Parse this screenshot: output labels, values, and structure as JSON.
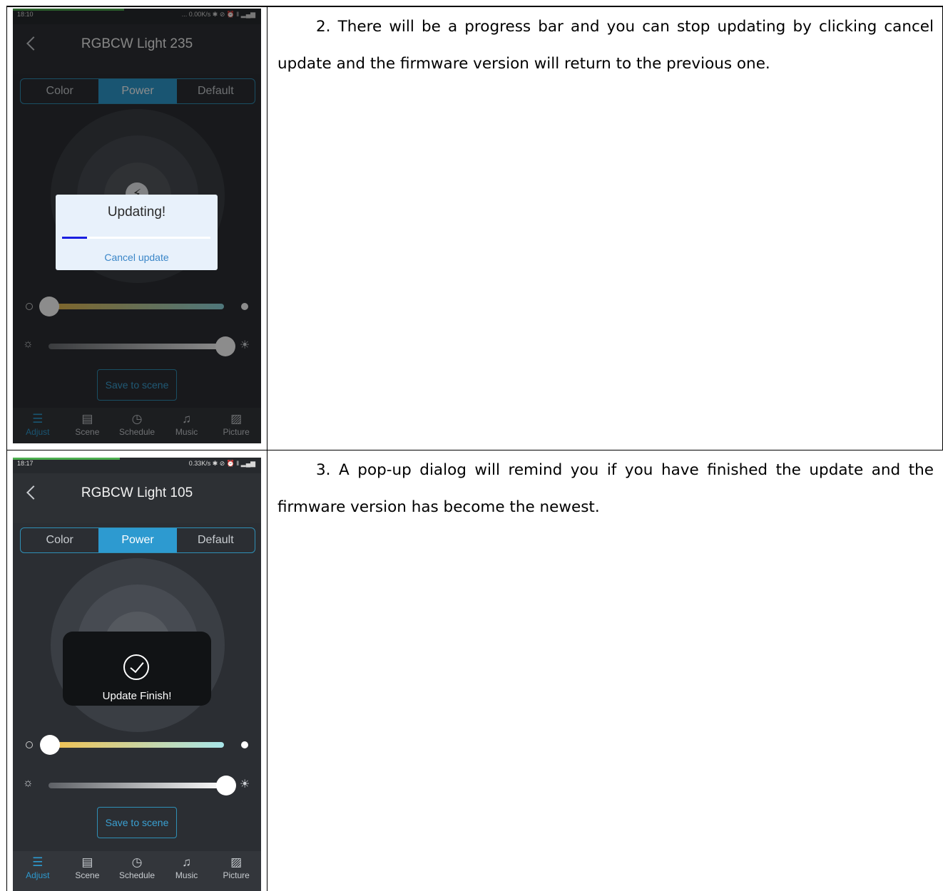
{
  "rows": [
    {
      "text": "2. There will be a progress bar and you can stop updating by clicking cancel update and the firmware version will return to the previous one.",
      "screenshot": {
        "status_time": "18:10",
        "status_net": "... 0.00K/s ✱ ⊘ ⏰ ‖ ▂▄▆",
        "title": "RGBCW Light 235",
        "tabs": [
          "Color",
          "Power",
          "Default"
        ],
        "active_tab": "Power",
        "save_label": "Save to scene",
        "nav": [
          "Adjust",
          "Scene",
          "Schedule",
          "Music",
          "Picture"
        ],
        "dialog": {
          "title": "Updating!",
          "progress": 0.17,
          "cancel_label": "Cancel update"
        }
      }
    },
    {
      "text": "3. A pop-up dialog will remind you if you have finished the update and the firmware version has become the newest.",
      "screenshot": {
        "status_time": "18:17",
        "status_net": "0.33K/s ✱ ⊘ ⏰ ‖ ▂▄▆",
        "title": "RGBCW Light 105",
        "tabs": [
          "Color",
          "Power",
          "Default"
        ],
        "active_tab": "Power",
        "save_label": "Save to scene",
        "nav": [
          "Adjust",
          "Scene",
          "Schedule",
          "Music",
          "Picture"
        ],
        "dialog": {
          "message": "Update Finish!"
        }
      }
    }
  ],
  "colors": {
    "accent": "#2d9ad0",
    "progress": "#1a1ee0",
    "status_bar_green": "#4cae4f"
  },
  "icons": {
    "nav": [
      "sliders-icon",
      "clapperboard-icon",
      "clock-icon",
      "music-note-icon",
      "picture-icon"
    ]
  }
}
